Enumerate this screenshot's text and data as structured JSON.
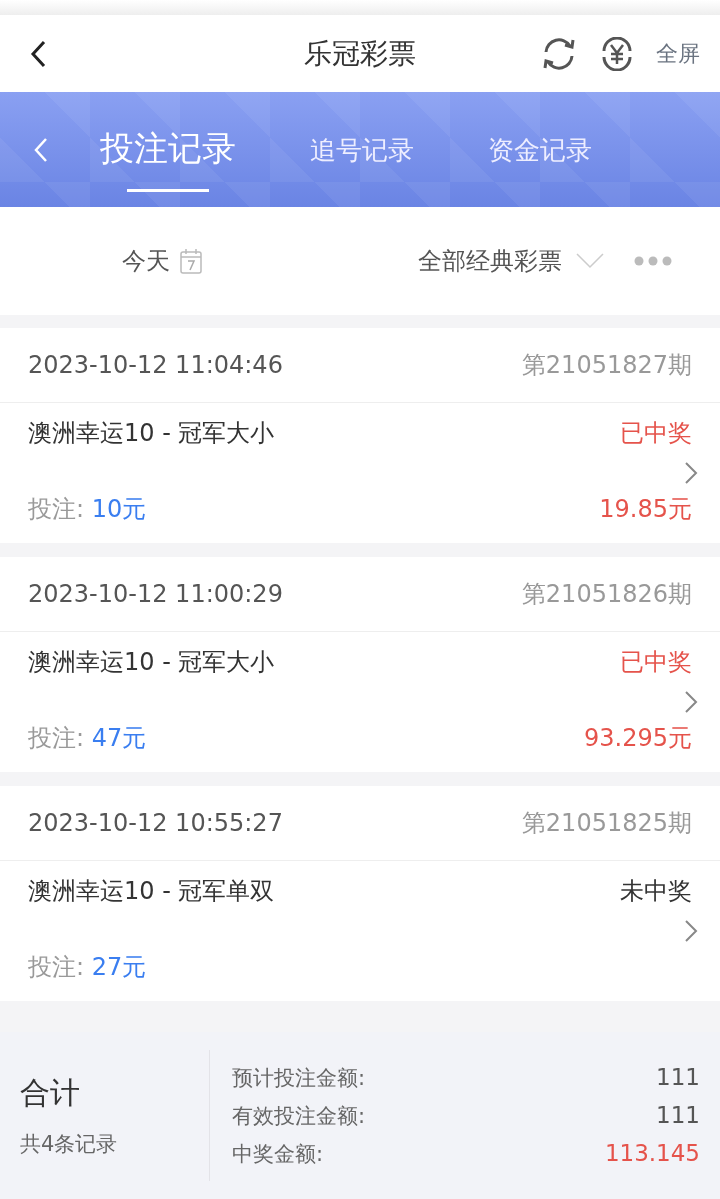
{
  "header": {
    "title": "乐冠彩票",
    "fullscreen": "全屏"
  },
  "tabs": [
    {
      "label": "投注记录",
      "selected": true
    },
    {
      "label": "追号记录",
      "selected": false
    },
    {
      "label": "资金记录",
      "selected": false
    }
  ],
  "filters": {
    "date": "今天",
    "category": "全部经典彩票"
  },
  "records": [
    {
      "time": "2023-10-12 11:04:46",
      "issue": "第21051827期",
      "game": "澳洲幸运10 - 冠军大小",
      "status": "已中奖",
      "won": true,
      "bet_label": "投注:",
      "bet": "10元",
      "payout": "19.85元"
    },
    {
      "time": "2023-10-12 11:00:29",
      "issue": "第21051826期",
      "game": "澳洲幸运10 - 冠军大小",
      "status": "已中奖",
      "won": true,
      "bet_label": "投注:",
      "bet": "47元",
      "payout": "93.295元"
    },
    {
      "time": "2023-10-12 10:55:27",
      "issue": "第21051825期",
      "game": "澳洲幸运10 - 冠军单双",
      "status": "未中奖",
      "won": false,
      "bet_label": "投注:",
      "bet": "27元"
    }
  ],
  "summary": {
    "title": "合计",
    "count": "共4条记录",
    "rows": [
      {
        "label": "预计投注金额:",
        "value": "111",
        "highlight": false
      },
      {
        "label": "有效投注金额:",
        "value": "111",
        "highlight": false
      },
      {
        "label": "中奖金额:",
        "value": "113.145",
        "highlight": true
      }
    ]
  }
}
